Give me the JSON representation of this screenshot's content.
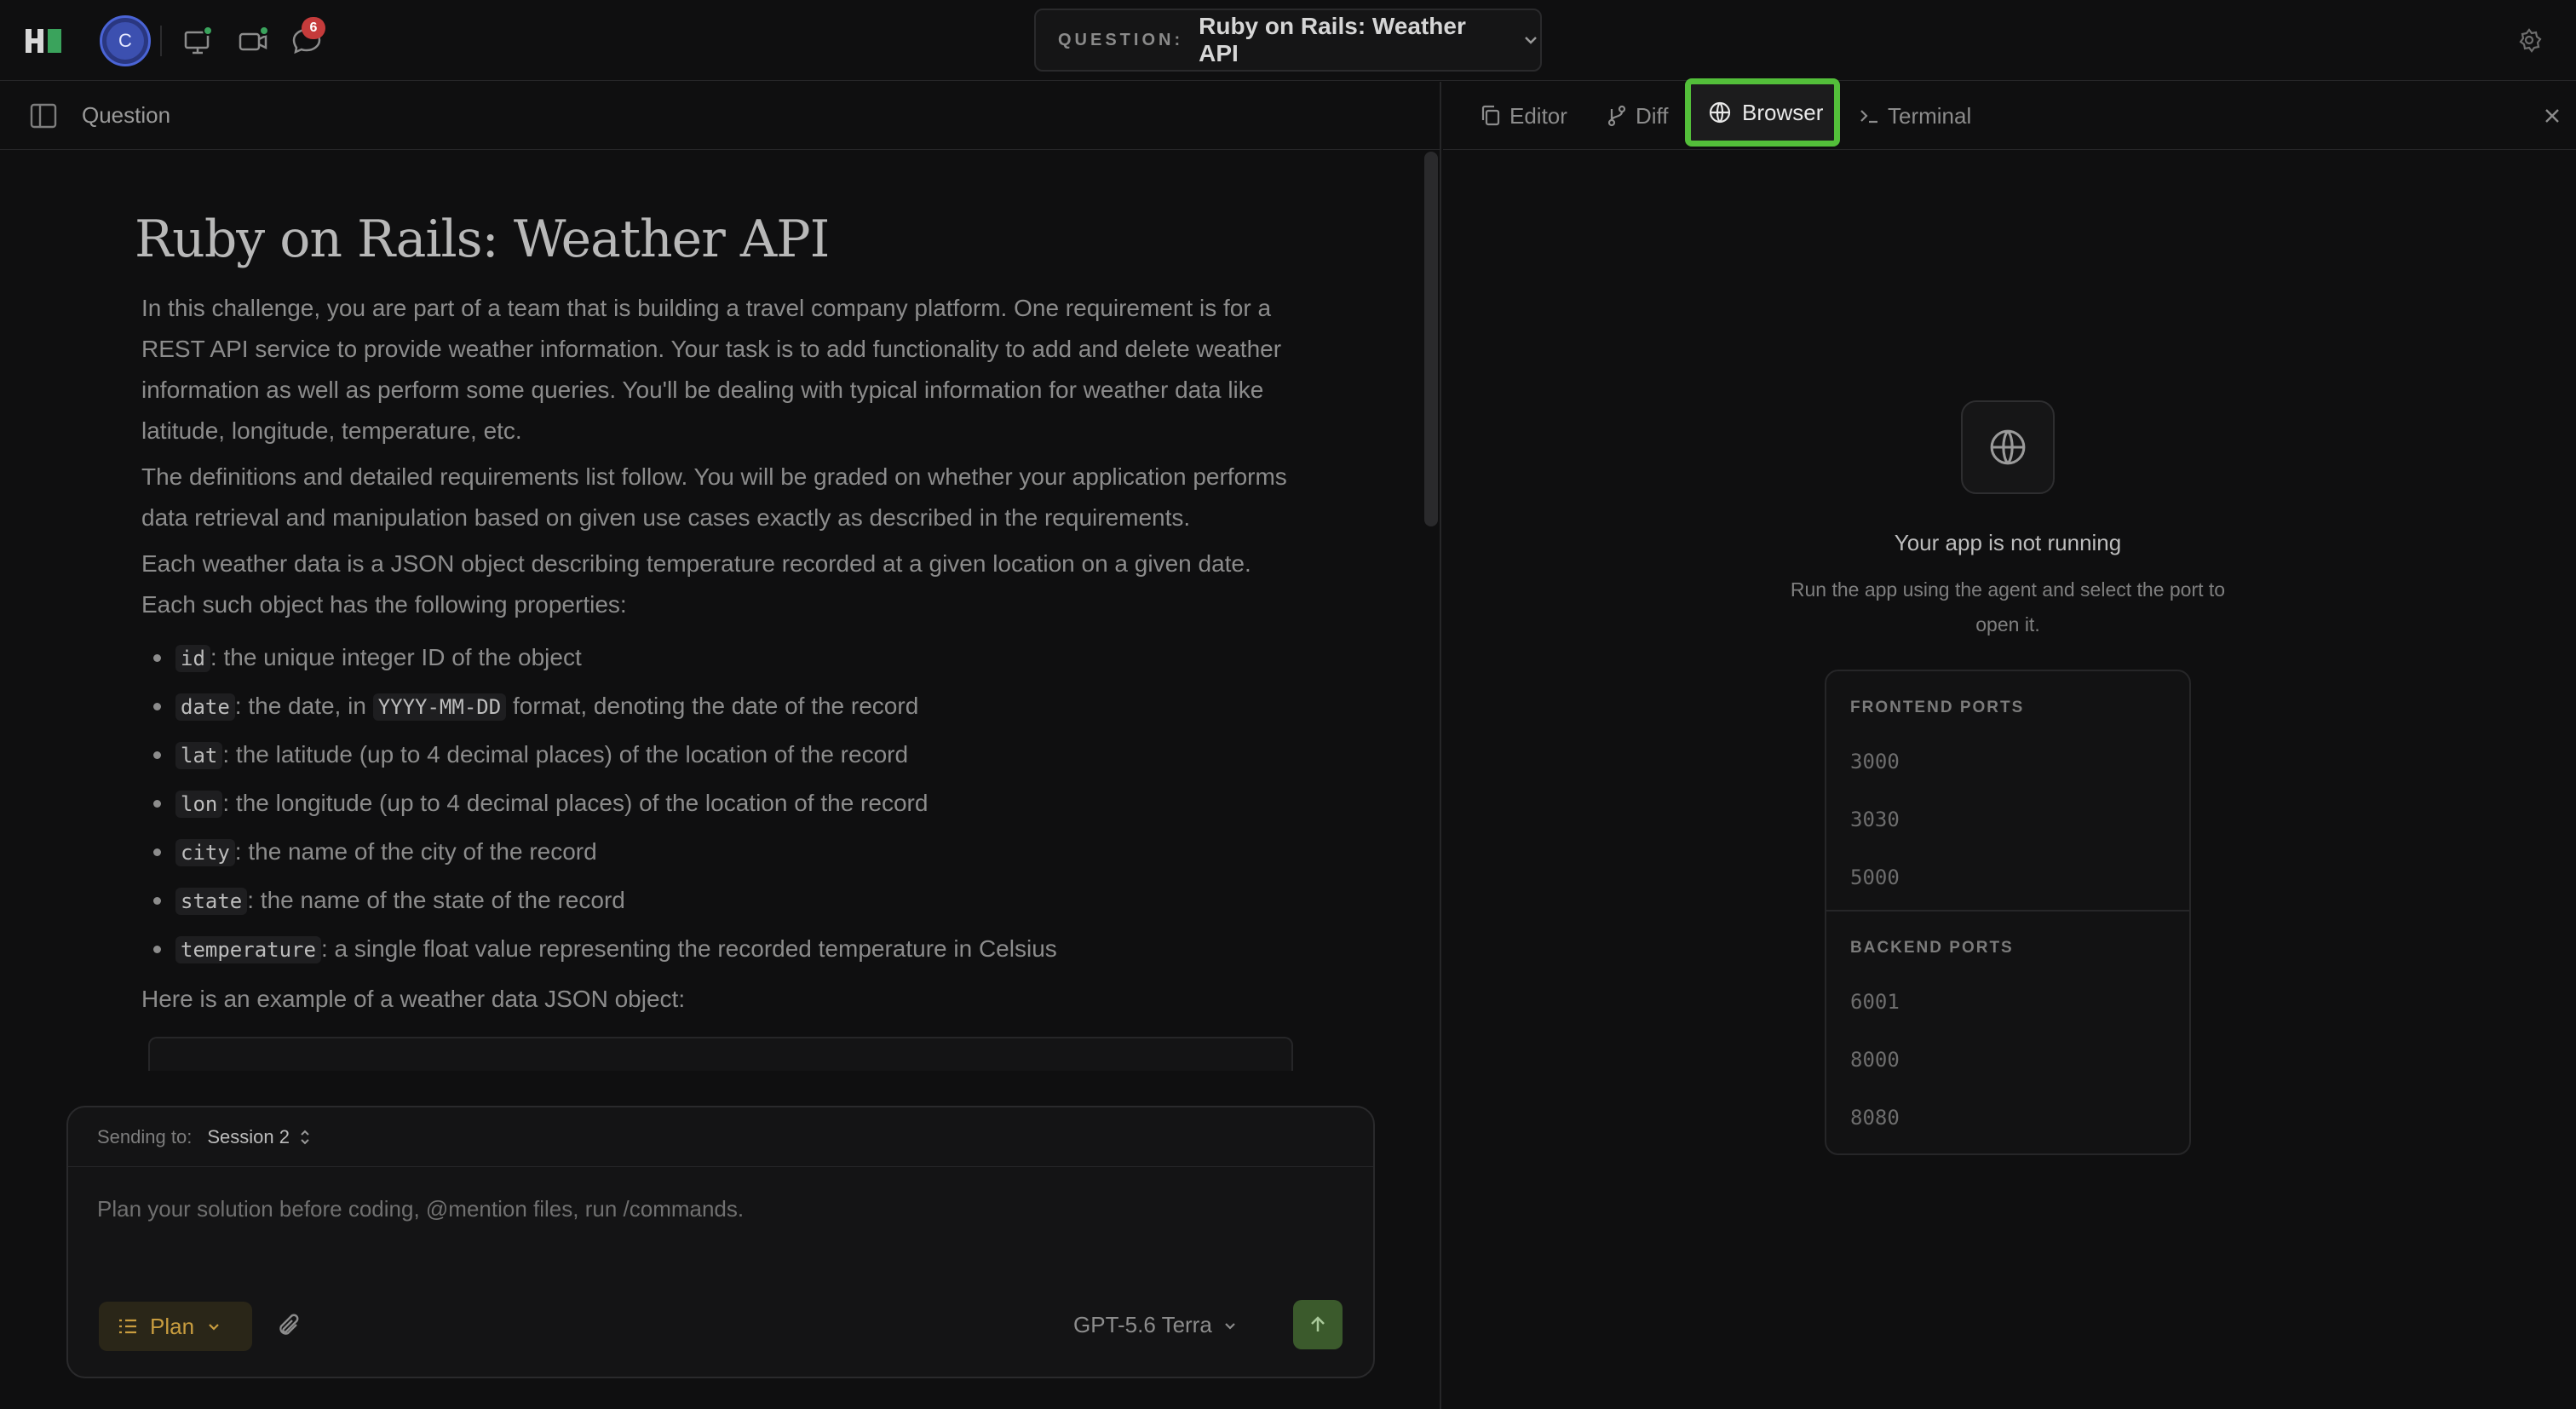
{
  "topbar": {
    "avatar_initial": "C",
    "notification_count": "6",
    "question_label": "QUESTION:",
    "question_title": "Ruby on Rails: Weather API"
  },
  "left_pane": {
    "header_title": "Question",
    "content": {
      "title": "Ruby on Rails: Weather API",
      "para1": "In this challenge, you are part of a team that is building a travel company platform. One requirement is for a REST API service to provide weather information. Your task is to add functionality to add and delete weather information as well as perform some queries. You'll be dealing with typical information for weather data like latitude, longitude, temperature, etc.",
      "para2": "The definitions and detailed requirements list follow. You will be graded on whether your application performs data retrieval and manipulation based on given use cases exactly as described in the requirements.",
      "para3": "Each weather data is a JSON object describing temperature recorded at a given location on a given date. Each such object has the following properties:",
      "properties": [
        {
          "key": "id",
          "text": ": the unique integer ID of the object"
        },
        {
          "key": "date",
          "pre": ": the date, in ",
          "code2": "YYYY-MM-DD",
          "text": " format, denoting the date of the record"
        },
        {
          "key": "lat",
          "text": ": the latitude (up to 4 decimal places) of the location of the record"
        },
        {
          "key": "lon",
          "text": ": the longitude (up to 4 decimal places) of the location of the record"
        },
        {
          "key": "city",
          "text": ": the name of the city of the record"
        },
        {
          "key": "state",
          "text": ": the name of the state of the record"
        },
        {
          "key": "temperature",
          "text": ": a single float value representing the recorded temperature in Celsius"
        }
      ],
      "para4": "Here is an example of a weather data JSON object:"
    },
    "composer": {
      "sending_to_label": "Sending to:",
      "session": "Session 2",
      "placeholder": "Plan your solution before coding, @mention files, run /commands.",
      "mode": "Plan",
      "model": "GPT-5.6 Terra"
    }
  },
  "right_pane": {
    "tabs": {
      "editor": "Editor",
      "diff": "Diff",
      "browser": "Browser",
      "terminal": "Terminal"
    },
    "empty_title": "Your app is not running",
    "empty_subtitle": "Run the app using the agent and select the port to open it.",
    "frontend_title": "FRONTEND PORTS",
    "frontend_ports": [
      "3000",
      "3030",
      "5000"
    ],
    "backend_title": "BACKEND PORTS",
    "backend_ports": [
      "6001",
      "8000",
      "8080"
    ]
  },
  "colors": {
    "accent_green": "#53bf3a",
    "plan_amber": "#c99d3f",
    "badge_red": "#c53b3b",
    "avatar_blue": "#4a64d6"
  },
  "icons": [
    "app-logo-icon",
    "monitor-icon",
    "video-camera-icon",
    "chat-bubble-icon",
    "chevron-down-icon",
    "settings-gear-icon",
    "sidebar-toggle-icon",
    "copy-icon",
    "branch-icon",
    "globe-icon",
    "terminal-prompt-icon",
    "close-icon",
    "list-icon",
    "paperclip-icon",
    "arrow-up-icon",
    "up-down-chevron-icon"
  ]
}
